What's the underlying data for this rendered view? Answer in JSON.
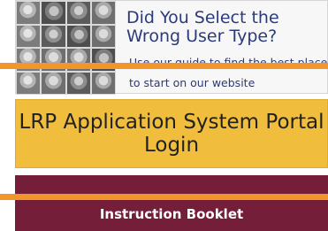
{
  "user_card": {
    "title": "Did You Select the Wrong User Type?",
    "subtitle": "Use our guide to find the best place to start on our website",
    "image_icon": "group-photo-collage"
  },
  "portal_login": {
    "label": "LRP Application System Portal Login"
  },
  "booklet": {
    "label": "Instruction Booklet"
  },
  "colors": {
    "title_blue": "#2b3a7b",
    "portal_gold": "#f0bd3c",
    "booklet_maroon": "#741e3a",
    "marker_orange": "#f2962b"
  }
}
